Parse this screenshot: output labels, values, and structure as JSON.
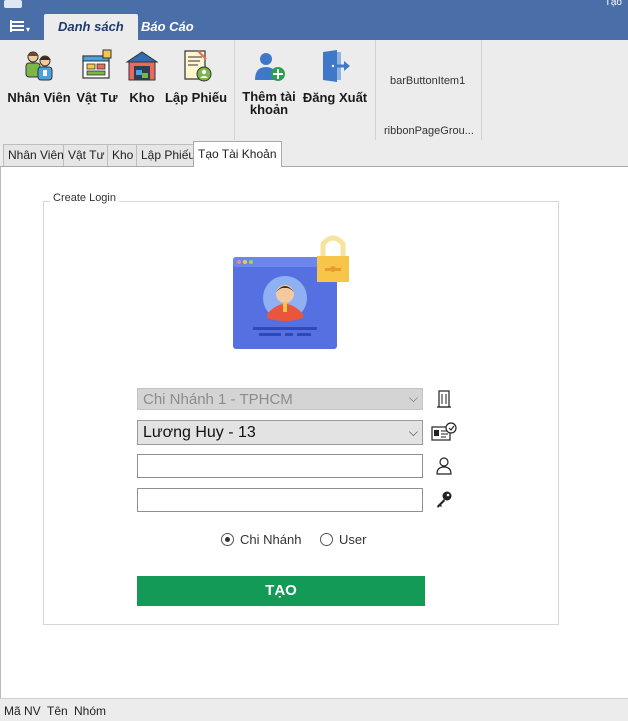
{
  "window": {
    "title": "Tạo"
  },
  "ribbon": {
    "tabs": [
      {
        "label": "Danh sách"
      },
      {
        "label": "Báo Cáo"
      }
    ],
    "buttons": {
      "nhan_vien": "Nhân Viên",
      "vat_tu": "Vật Tư",
      "kho": "Kho",
      "lap_phieu": "Lập Phiếu",
      "them_tai_khoan_line1": "Thêm tài",
      "them_tai_khoan_line2": "khoản",
      "dang_xuat": "Đăng Xuất",
      "bar_button_item": "barButtonItem1"
    },
    "page_group_label": "ribbonPageGrou..."
  },
  "doc_tabs": [
    {
      "label": "Nhân Viên"
    },
    {
      "label": "Vật Tư"
    },
    {
      "label": "Kho"
    },
    {
      "label": "Lập Phiếu"
    },
    {
      "label": "Tạo Tài Khoản"
    }
  ],
  "form": {
    "group_title": "Create Login",
    "branch": {
      "value": "Chi Nhánh 1 - TPHCM"
    },
    "employee": {
      "value": "Lương Huy - 13"
    },
    "login_name": {
      "value": ""
    },
    "password": {
      "value": ""
    },
    "role_options": [
      {
        "label": "Chi Nhánh",
        "selected": true
      },
      {
        "label": "User",
        "selected": false
      }
    ],
    "submit_label": "TẠO"
  },
  "statusbar": {
    "ma_nv": "Mã NV",
    "ten": "Tên",
    "nhom": "Nhóm"
  },
  "colors": {
    "header_blue": "#4a6ea8",
    "ribbon_bg": "#ececec",
    "create_green": "#149a57",
    "illustration_blue": "#5570e0",
    "lock_yellow": "#f7c548"
  }
}
